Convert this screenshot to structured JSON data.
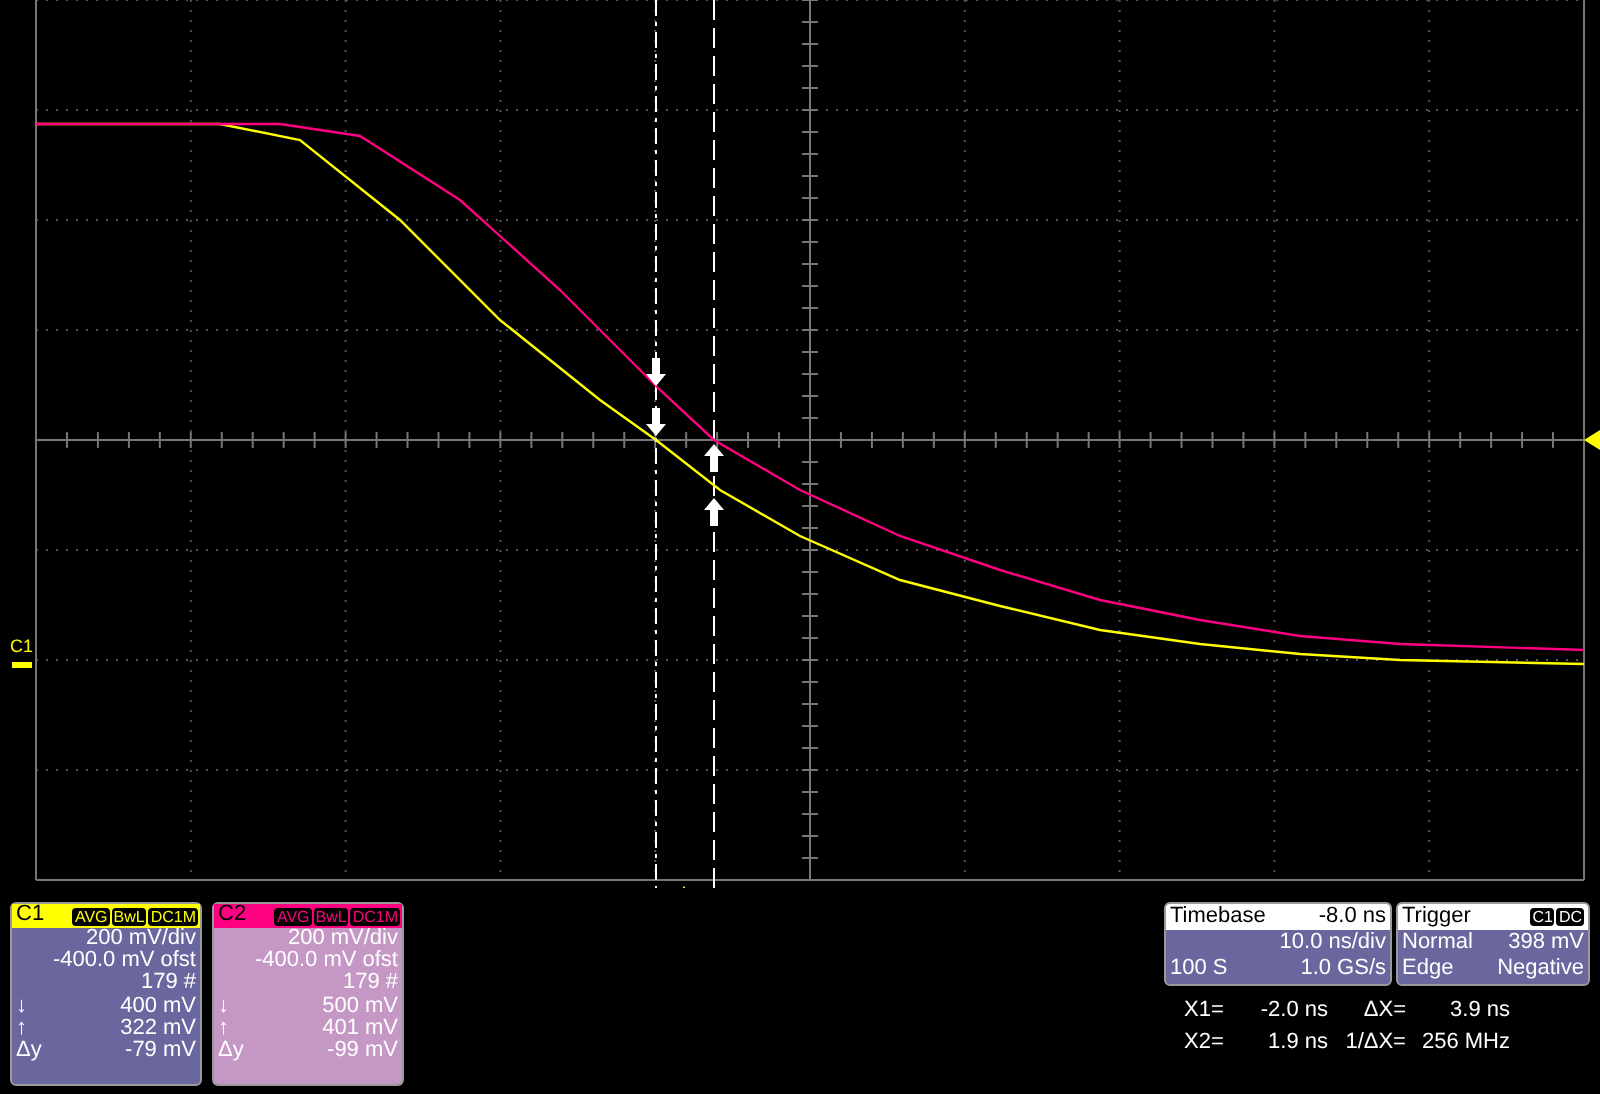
{
  "plot": {
    "ground_marker": "C1"
  },
  "channels": [
    {
      "name": "C1",
      "color": "#ffff00",
      "tags": [
        "AVG",
        "BwL",
        "DC1M"
      ],
      "scale": "200 mV/div",
      "offset": "-400.0 mV ofst",
      "sweeps": "179 #",
      "rows": [
        {
          "label": "↓",
          "value": "400 mV"
        },
        {
          "label": "↑",
          "value": "322 mV"
        },
        {
          "label": "Δy",
          "value": "-79 mV"
        }
      ]
    },
    {
      "name": "C2",
      "color": "#ff0080",
      "tags": [
        "AVG",
        "BwL",
        "DC1M"
      ],
      "scale": "200 mV/div",
      "offset": "-400.0 mV ofst",
      "sweeps": "179 #",
      "rows": [
        {
          "label": "↓",
          "value": "500 mV"
        },
        {
          "label": "↑",
          "value": "401 mV"
        },
        {
          "label": "Δy",
          "value": "-99 mV"
        }
      ]
    }
  ],
  "timebase": {
    "title": "Timebase",
    "delay": "-8.0 ns",
    "scale": "10.0 ns/div",
    "samples": "100 S",
    "rate": "1.0 GS/s"
  },
  "trigger": {
    "title": "Trigger",
    "source": "C1",
    "coupling": "DC",
    "mode": "Normal",
    "level": "398 mV",
    "type": "Edge",
    "slope": "Negative"
  },
  "cursors": [
    {
      "label": "X1=",
      "value": "-2.0 ns",
      "label2": "ΔX=",
      "value2": "3.9 ns"
    },
    {
      "label": "X2=",
      "value": "1.9 ns",
      "label2": "1/ΔX=",
      "value2": "256 MHz"
    }
  ]
}
